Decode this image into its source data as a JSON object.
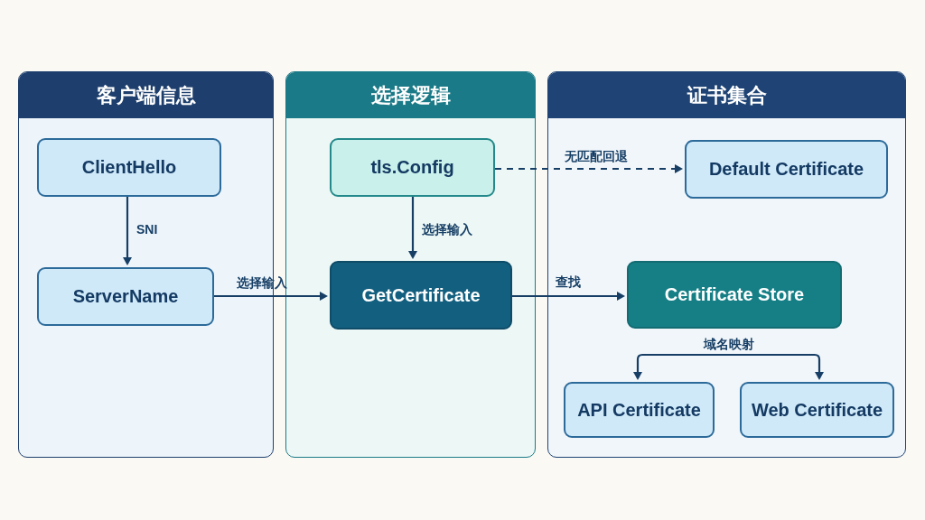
{
  "panels": [
    {
      "title": "客户端信息",
      "color": "#1e3f6d"
    },
    {
      "title": "选择逻辑",
      "color": "#1b7a87"
    },
    {
      "title": "证书集合",
      "color": "#1e4374"
    }
  ],
  "nodes": [
    {
      "label": "ClientHello",
      "kind": "light"
    },
    {
      "label": "ServerName",
      "kind": "light"
    },
    {
      "label": "tls.Config",
      "kind": "mint"
    },
    {
      "label": "GetCertificate",
      "kind": "dark"
    },
    {
      "label": "Default Certificate",
      "kind": "light"
    },
    {
      "label": "Certificate Store",
      "kind": "teal"
    },
    {
      "label": "API Certificate",
      "kind": "light"
    },
    {
      "label": "Web Certificate",
      "kind": "light"
    }
  ],
  "edges": [
    {
      "label": "SNI",
      "kind": "solid"
    },
    {
      "label": "选择输入",
      "kind": "solid"
    },
    {
      "label": "选择输入",
      "kind": "solid"
    },
    {
      "label": "无匹配回退",
      "kind": "dashed"
    },
    {
      "label": "查找",
      "kind": "solid"
    },
    {
      "label": "域名映射",
      "kind": "branch"
    }
  ]
}
